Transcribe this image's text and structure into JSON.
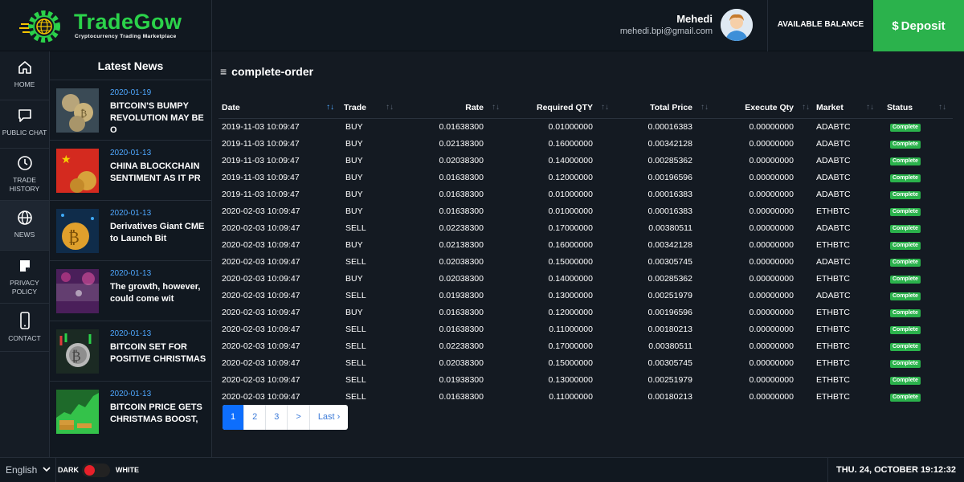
{
  "brand": {
    "name": "TradeGow",
    "tagline": "Cryptocurrency Trading Marketplace",
    "accent": "#2bd24a"
  },
  "user": {
    "name": "Mehedi",
    "email": "mehedi.bpi@gmail.com"
  },
  "header": {
    "balance_label": "AVAILABLE BALANCE",
    "deposit_label": "Deposit",
    "deposit_icon": "$"
  },
  "nav": {
    "items": [
      {
        "label": "HOME",
        "icon": "home-icon"
      },
      {
        "label": "PUBLIC CHAT",
        "icon": "chat-icon"
      },
      {
        "label_1": "TRADE",
        "label_2": "HISTORY",
        "icon": "clock-icon"
      },
      {
        "label": "NEWS",
        "icon": "globe-icon",
        "active": true
      },
      {
        "label_1": "PRIVACY",
        "label_2": "POLICY",
        "icon": "note-icon"
      },
      {
        "label": "CONTACT",
        "icon": "phone-icon"
      }
    ]
  },
  "news": {
    "heading": "Latest News",
    "items": [
      {
        "date": "2020-01-19",
        "title": "BITCOIN'S BUMPY REVOLUTION MAY BE O"
      },
      {
        "date": "2020-01-13",
        "title": "CHINA BLOCKCHAIN SENTIMENT AS IT PR"
      },
      {
        "date": "2020-01-13",
        "title": "Derivatives Giant CME to Launch Bit"
      },
      {
        "date": "2020-01-13",
        "title": "The growth, however, could come wit"
      },
      {
        "date": "2020-01-13",
        "title": "BITCOIN SET FOR POSITIVE CHRISTMAS"
      },
      {
        "date": "2020-01-13",
        "title": "BITCOIN PRICE GETS CHRISTMAS BOOST,"
      }
    ]
  },
  "main": {
    "title": "complete-order",
    "columns": [
      "Date",
      "Trade",
      "Rate",
      "Required QTY",
      "Total Price",
      "Execute Qty",
      "Market",
      "Status"
    ],
    "rows": [
      [
        "2019-11-03 10:09:47",
        "BUY",
        "0.01638300",
        "0.01000000",
        "0.00016383",
        "0.00000000",
        "ADABTC",
        "Complete"
      ],
      [
        "2019-11-03 10:09:47",
        "BUY",
        "0.02138300",
        "0.16000000",
        "0.00342128",
        "0.00000000",
        "ADABTC",
        "Complete"
      ],
      [
        "2019-11-03 10:09:47",
        "BUY",
        "0.02038300",
        "0.14000000",
        "0.00285362",
        "0.00000000",
        "ADABTC",
        "Complete"
      ],
      [
        "2019-11-03 10:09:47",
        "BUY",
        "0.01638300",
        "0.12000000",
        "0.00196596",
        "0.00000000",
        "ADABTC",
        "Complete"
      ],
      [
        "2019-11-03 10:09:47",
        "BUY",
        "0.01638300",
        "0.01000000",
        "0.00016383",
        "0.00000000",
        "ADABTC",
        "Complete"
      ],
      [
        "2020-02-03 10:09:47",
        "BUY",
        "0.01638300",
        "0.01000000",
        "0.00016383",
        "0.00000000",
        "ETHBTC",
        "Complete"
      ],
      [
        "2020-02-03 10:09:47",
        "SELL",
        "0.02238300",
        "0.17000000",
        "0.00380511",
        "0.00000000",
        "ADABTC",
        "Complete"
      ],
      [
        "2020-02-03 10:09:47",
        "BUY",
        "0.02138300",
        "0.16000000",
        "0.00342128",
        "0.00000000",
        "ETHBTC",
        "Complete"
      ],
      [
        "2020-02-03 10:09:47",
        "SELL",
        "0.02038300",
        "0.15000000",
        "0.00305745",
        "0.00000000",
        "ADABTC",
        "Complete"
      ],
      [
        "2020-02-03 10:09:47",
        "BUY",
        "0.02038300",
        "0.14000000",
        "0.00285362",
        "0.00000000",
        "ETHBTC",
        "Complete"
      ],
      [
        "2020-02-03 10:09:47",
        "SELL",
        "0.01938300",
        "0.13000000",
        "0.00251979",
        "0.00000000",
        "ADABTC",
        "Complete"
      ],
      [
        "2020-02-03 10:09:47",
        "BUY",
        "0.01638300",
        "0.12000000",
        "0.00196596",
        "0.00000000",
        "ETHBTC",
        "Complete"
      ],
      [
        "2020-02-03 10:09:47",
        "SELL",
        "0.01638300",
        "0.11000000",
        "0.00180213",
        "0.00000000",
        "ETHBTC",
        "Complete"
      ],
      [
        "2020-02-03 10:09:47",
        "SELL",
        "0.02238300",
        "0.17000000",
        "0.00380511",
        "0.00000000",
        "ETHBTC",
        "Complete"
      ],
      [
        "2020-02-03 10:09:47",
        "SELL",
        "0.02038300",
        "0.15000000",
        "0.00305745",
        "0.00000000",
        "ETHBTC",
        "Complete"
      ],
      [
        "2020-02-03 10:09:47",
        "SELL",
        "0.01938300",
        "0.13000000",
        "0.00251979",
        "0.00000000",
        "ETHBTC",
        "Complete"
      ],
      [
        "2020-02-03 10:09:47",
        "SELL",
        "0.01638300",
        "0.11000000",
        "0.00180213",
        "0.00000000",
        "ETHBTC",
        "Complete"
      ]
    ],
    "pagination": [
      "1",
      "2",
      "3",
      ">",
      "Last ›"
    ],
    "current_page": "1"
  },
  "footer": {
    "language": "English",
    "dark_label": "DARK",
    "white_label": "WHITE",
    "datetime": "THU. 24, OCTOBER  19:12:32"
  }
}
